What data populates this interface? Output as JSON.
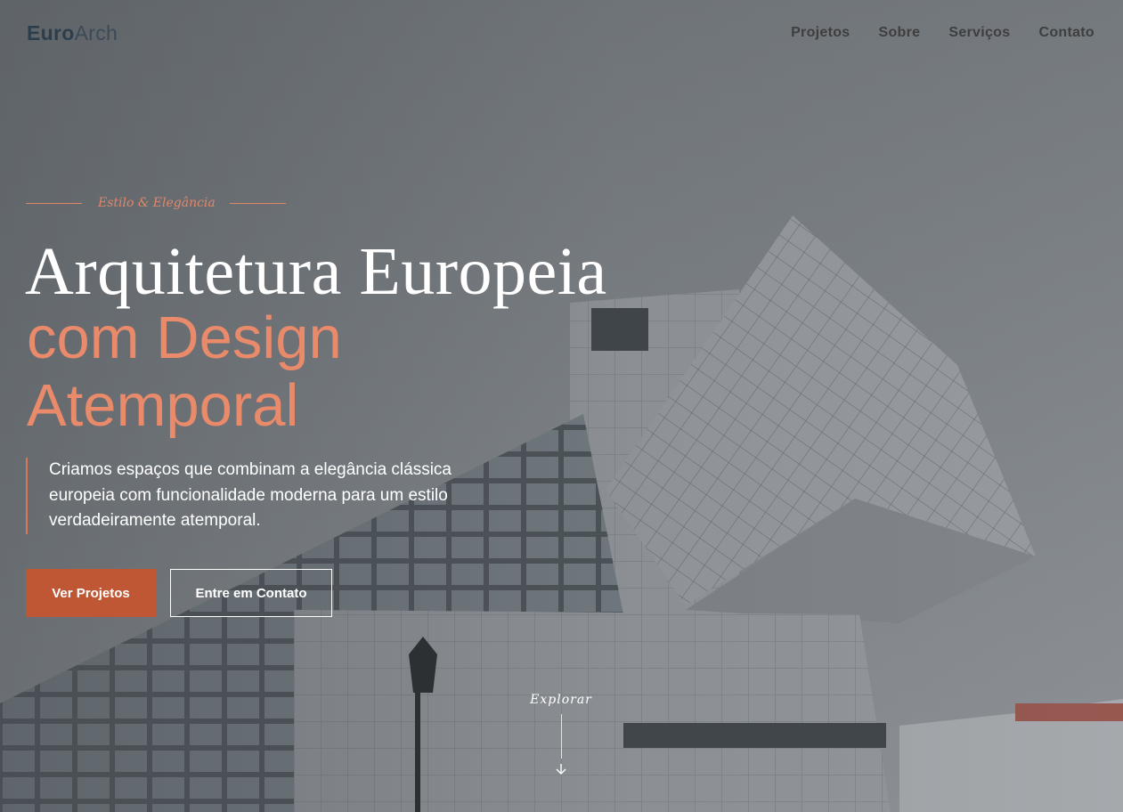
{
  "logo": {
    "part1": "Euro",
    "part2": "Arch"
  },
  "nav": {
    "items": [
      "Projetos",
      "Sobre",
      "Serviços",
      "Contato"
    ]
  },
  "hero": {
    "eyebrow": "Estilo & Elegância",
    "title_line1": "Arquitetura Europeia",
    "title_line2": "com Design",
    "title_line3": "Atemporal",
    "lead_line1": "Criamos espaços que combinam a elegância clássica",
    "lead_line2": "europeia com funcionalidade moderna para um estilo",
    "lead_line3": "verdadeiramente atemporal.",
    "primary_button": "Ver Projetos",
    "secondary_button": "Entre em Contato",
    "explore_label": "Explorar"
  },
  "colors": {
    "accent": "#bf5634",
    "accent_light": "#e98a6a",
    "logo_dark": "#2c3e4c"
  },
  "icons": {
    "explore": "arrow-down-icon"
  }
}
